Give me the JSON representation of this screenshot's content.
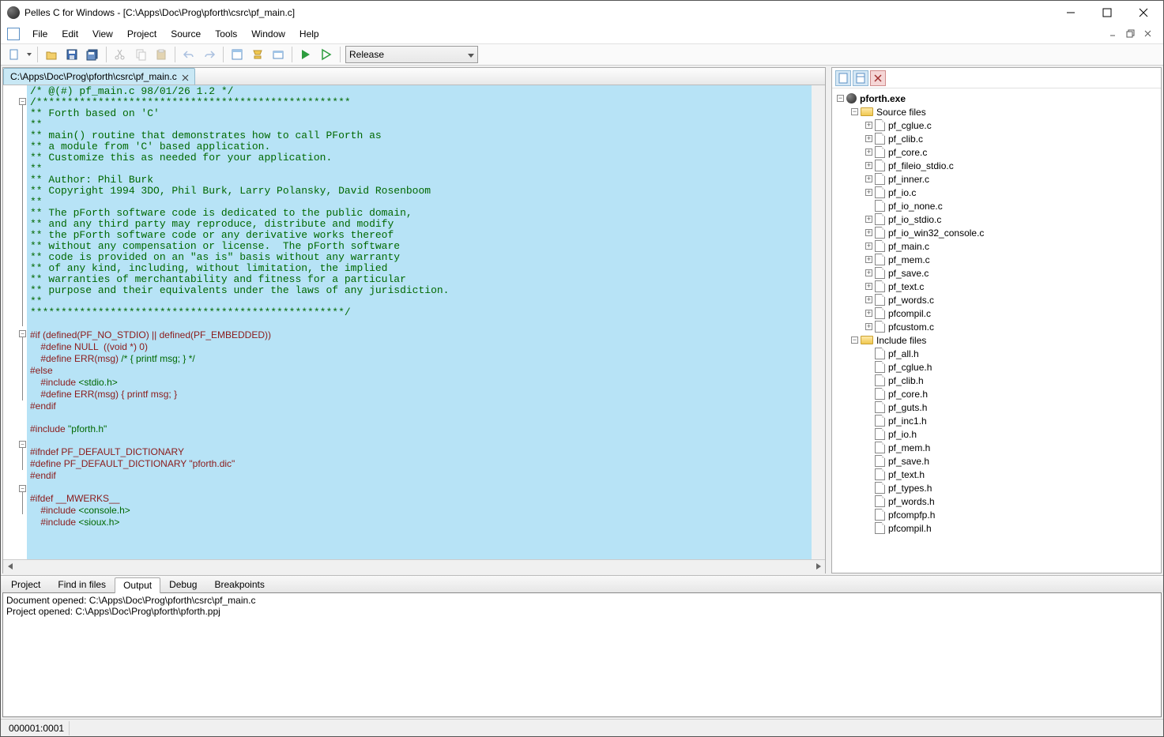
{
  "window": {
    "title": "Pelles C for Windows - [C:\\Apps\\Doc\\Prog\\pforth\\csrc\\pf_main.c]"
  },
  "menu": {
    "items": [
      "File",
      "Edit",
      "View",
      "Project",
      "Source",
      "Tools",
      "Window",
      "Help"
    ]
  },
  "toolbar": {
    "config_selected": "Release"
  },
  "editor": {
    "tab_label": "C:\\Apps\\Doc\\Prog\\pforth\\csrc\\pf_main.c",
    "lines": [
      {
        "t": "/* @(#) pf_main.c 98/01/26 1.2 */",
        "c": "cm"
      },
      {
        "t": "/***************************************************",
        "c": "cm"
      },
      {
        "t": "** Forth based on 'C'",
        "c": "cm"
      },
      {
        "t": "**",
        "c": "cm"
      },
      {
        "t": "** main() routine that demonstrates how to call PForth as",
        "c": "cm"
      },
      {
        "t": "** a module from 'C' based application.",
        "c": "cm"
      },
      {
        "t": "** Customize this as needed for your application.",
        "c": "cm"
      },
      {
        "t": "**",
        "c": "cm"
      },
      {
        "t": "** Author: Phil Burk",
        "c": "cm"
      },
      {
        "t": "** Copyright 1994 3DO, Phil Burk, Larry Polansky, David Rosenboom",
        "c": "cm"
      },
      {
        "t": "**",
        "c": "cm"
      },
      {
        "t": "** The pForth software code is dedicated to the public domain,",
        "c": "cm"
      },
      {
        "t": "** and any third party may reproduce, distribute and modify",
        "c": "cm"
      },
      {
        "t": "** the pForth software code or any derivative works thereof",
        "c": "cm"
      },
      {
        "t": "** without any compensation or license.  The pForth software",
        "c": "cm"
      },
      {
        "t": "** code is provided on an \"as is\" basis without any warranty",
        "c": "cm"
      },
      {
        "t": "** of any kind, including, without limitation, the implied",
        "c": "cm"
      },
      {
        "t": "** warranties of merchantability and fitness for a particular",
        "c": "cm"
      },
      {
        "t": "** purpose and their equivalents under the laws of any jurisdiction.",
        "c": "cm"
      },
      {
        "t": "**",
        "c": "cm"
      },
      {
        "t": "***************************************************/",
        "c": "cm"
      },
      {
        "t": "",
        "c": ""
      },
      {
        "t": "#if (defined(PF_NO_STDIO) || defined(PF_EMBEDDED))",
        "c": "pp"
      },
      {
        "t": "    #define NULL  ((void *) 0)",
        "c": "pp"
      },
      {
        "t": "    #define ERR(msg) /* { printf msg; } */",
        "c": "ppmix"
      },
      {
        "t": "#else",
        "c": "pp"
      },
      {
        "t": "    #include <stdio.h>",
        "c": "ppinc"
      },
      {
        "t": "    #define ERR(msg) { printf msg; }",
        "c": "pp"
      },
      {
        "t": "#endif",
        "c": "pp"
      },
      {
        "t": "",
        "c": ""
      },
      {
        "t": "#include \"pforth.h\"",
        "c": "ppinc"
      },
      {
        "t": "",
        "c": ""
      },
      {
        "t": "#ifndef PF_DEFAULT_DICTIONARY",
        "c": "pp"
      },
      {
        "t": "#define PF_DEFAULT_DICTIONARY \"pforth.dic\"",
        "c": "pp"
      },
      {
        "t": "#endif",
        "c": "pp"
      },
      {
        "t": "",
        "c": ""
      },
      {
        "t": "#ifdef __MWERKS__",
        "c": "pp"
      },
      {
        "t": "    #include <console.h>",
        "c": "ppinc"
      },
      {
        "t": "    #include <sioux.h>",
        "c": "ppinc"
      }
    ]
  },
  "project_tree": {
    "root": "pforth.exe",
    "folders": [
      {
        "name": "Source files",
        "expanded": true,
        "items": [
          {
            "n": "pf_cglue.c",
            "exp": "+"
          },
          {
            "n": "pf_clib.c",
            "exp": "+"
          },
          {
            "n": "pf_core.c",
            "exp": "+"
          },
          {
            "n": "pf_fileio_stdio.c",
            "exp": "+"
          },
          {
            "n": "pf_inner.c",
            "exp": "+"
          },
          {
            "n": "pf_io.c",
            "exp": "+"
          },
          {
            "n": "pf_io_none.c",
            "exp": ""
          },
          {
            "n": "pf_io_stdio.c",
            "exp": "+"
          },
          {
            "n": "pf_io_win32_console.c",
            "exp": "+"
          },
          {
            "n": "pf_main.c",
            "exp": "+"
          },
          {
            "n": "pf_mem.c",
            "exp": "+"
          },
          {
            "n": "pf_save.c",
            "exp": "+"
          },
          {
            "n": "pf_text.c",
            "exp": "+"
          },
          {
            "n": "pf_words.c",
            "exp": "+"
          },
          {
            "n": "pfcompil.c",
            "exp": "+"
          },
          {
            "n": "pfcustom.c",
            "exp": "+"
          }
        ]
      },
      {
        "name": "Include files",
        "expanded": true,
        "items": [
          {
            "n": "pf_all.h",
            "exp": ""
          },
          {
            "n": "pf_cglue.h",
            "exp": ""
          },
          {
            "n": "pf_clib.h",
            "exp": ""
          },
          {
            "n": "pf_core.h",
            "exp": ""
          },
          {
            "n": "pf_guts.h",
            "exp": ""
          },
          {
            "n": "pf_inc1.h",
            "exp": ""
          },
          {
            "n": "pf_io.h",
            "exp": ""
          },
          {
            "n": "pf_mem.h",
            "exp": ""
          },
          {
            "n": "pf_save.h",
            "exp": ""
          },
          {
            "n": "pf_text.h",
            "exp": ""
          },
          {
            "n": "pf_types.h",
            "exp": ""
          },
          {
            "n": "pf_words.h",
            "exp": ""
          },
          {
            "n": "pfcompfp.h",
            "exp": ""
          },
          {
            "n": "pfcompil.h",
            "exp": ""
          }
        ]
      }
    ]
  },
  "bottom_tabs": {
    "items": [
      "Project",
      "Find in files",
      "Output",
      "Debug",
      "Breakpoints"
    ],
    "active": 2
  },
  "output": {
    "lines": [
      "Document opened: C:\\Apps\\Doc\\Prog\\pforth\\csrc\\pf_main.c",
      "Project opened: C:\\Apps\\Doc\\Prog\\pforth\\pforth.ppj"
    ]
  },
  "status": {
    "pos": "000001:0001"
  }
}
